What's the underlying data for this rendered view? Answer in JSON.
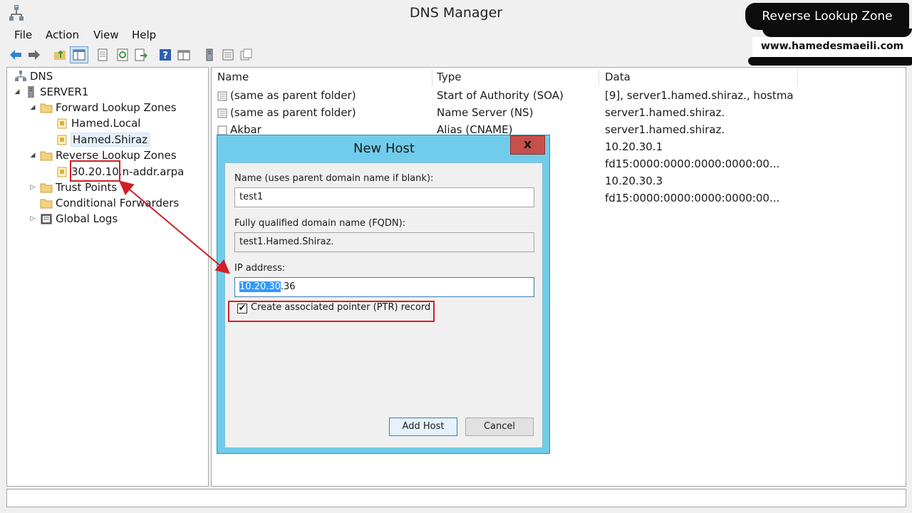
{
  "window": {
    "title": "DNS Manager"
  },
  "menu": [
    "File",
    "Action",
    "View",
    "Help"
  ],
  "toolbar": [
    "back-icon",
    "forward-icon",
    "up-folder-icon",
    "show-hide-tree-icon",
    "properties-icon",
    "refresh-icon",
    "export-list-icon",
    "help-icon",
    "console-icon",
    "server-icon",
    "list-icon",
    "records-icon"
  ],
  "tree": {
    "root": "DNS",
    "server": "SERVER1",
    "forward": "Forward Lookup Zones",
    "forward_zones": [
      "Hamed.Local",
      "Hamed.Shiraz"
    ],
    "reverse": "Reverse Lookup Zones",
    "reverse_zone_prefix": "30.20.10.",
    "reverse_zone_suffix": "n-addr.arpa",
    "trust": "Trust Points",
    "forwarders": "Conditional Forwarders",
    "logs": "Global Logs"
  },
  "list": {
    "columns": [
      "Name",
      "Type",
      "Data"
    ],
    "rows": [
      {
        "name": "(same as parent folder)",
        "type": "Start of Authority (SOA)",
        "data": "[9], server1.hamed.shiraz., hostma..."
      },
      {
        "name": "(same as parent folder)",
        "type": "Name Server (NS)",
        "data": "server1.hamed.shiraz."
      },
      {
        "name": "Akbar",
        "type": "Alias (CNAME)",
        "data": "server1.hamed.shiraz."
      },
      {
        "name": "",
        "type": "",
        "data": "10.20.30.1"
      },
      {
        "name": "",
        "type": "",
        "data": "fd15:0000:0000:0000:0000:00..."
      },
      {
        "name": "",
        "type": "",
        "data": "10.20.30.3"
      },
      {
        "name": "",
        "type": "",
        "data": "fd15:0000:0000:0000:0000:00..."
      }
    ]
  },
  "dialog": {
    "title": "New Host",
    "close": "x",
    "name_label": "Name (uses parent domain name if blank):",
    "name_value": "test1",
    "fqdn_label": "Fully qualified domain name (FQDN):",
    "fqdn_value": "test1.Hamed.Shiraz.",
    "ip_label": "IP address:",
    "ip_selected": "10.20.30",
    "ip_rest": ".36",
    "ptr_label": "Create associated pointer (PTR) record",
    "ptr_checked": true,
    "add_button": "Add Host",
    "cancel_button": "Cancel"
  },
  "banner": {
    "title": "Reverse Lookup Zone",
    "site": "www.hamedesmaeili.com"
  },
  "colors": {
    "annotation": "#d21f26",
    "dialog_frame": "#6fcdeb",
    "selection": "#3399ff"
  }
}
